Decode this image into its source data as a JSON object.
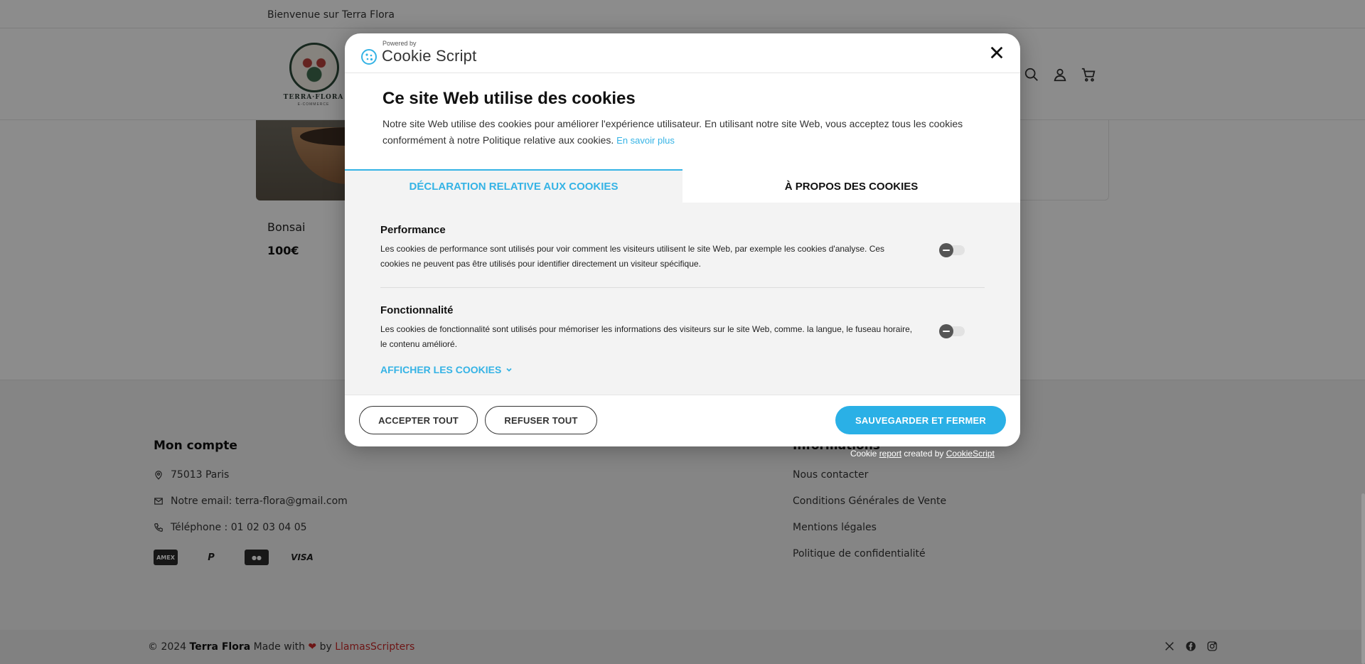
{
  "topbar": {
    "welcome": "Bienvenue sur Terra Flora"
  },
  "logo": {
    "name": "TERRA·FLORA",
    "sub": "E-COMMERCE"
  },
  "product": {
    "name": "Bonsai",
    "price": "100€"
  },
  "footer": {
    "account_title": "Mon compte",
    "address": "75013 Paris",
    "email": "Notre email: terra-flora@gmail.com",
    "phone": "Téléphone : 01 02 03 04 05",
    "payments": [
      "AMERICAN EXPRESS",
      "P",
      "MC",
      "VISA"
    ],
    "info_title": "Informations",
    "links": [
      "Nous contacter",
      "Conditions Générales de Vente",
      "Mentions légales",
      "Politique de confidentialité"
    ]
  },
  "bottombar": {
    "copy_prefix": "© 2024 ",
    "brand": "Terra Flora",
    "made_with": " Made with ",
    "heart": "❤",
    "by": " by ",
    "author": "LlamasScripters"
  },
  "dialog": {
    "powered_by": "Powered by",
    "brand_name": "Cookie Script",
    "title": "Ce site Web utilise des cookies",
    "text": "Notre site Web utilise des cookies pour améliorer l'expérience utilisateur. En utilisant notre site Web, vous acceptez tous les cookies conformément à notre Politique relative aux cookies.",
    "learn_more": "En savoir plus",
    "tabs": [
      {
        "label": "DÉCLARATION RELATIVE AUX COOKIES",
        "active": true
      },
      {
        "label": "À PROPOS DES COOKIES",
        "active": false
      }
    ],
    "categories": [
      {
        "title": "Performance",
        "description": "Les cookies de performance sont utilisés pour voir comment les visiteurs utilisent le site Web, par exemple les cookies d'analyse. Ces cookies ne peuvent pas être utilisés pour identifier directement un visiteur spécifique.",
        "enabled": false
      },
      {
        "title": "Fonctionnalité",
        "description": "Les cookies de fonctionnalité sont utilisés pour mémoriser les informations des visiteurs sur le site Web, comme. la langue, le fuseau horaire, le contenu amélioré.",
        "enabled": false
      }
    ],
    "show_cookies": "AFFICHER LES COOKIES",
    "buttons": {
      "accept_all": "ACCEPTER TOUT",
      "reject_all": "REFUSER TOUT",
      "save_close": "SAUVEGARDER ET FERMER"
    }
  },
  "credit": {
    "prefix": "Cookie ",
    "report": "report",
    "middle": " created by ",
    "link": "CookieScript"
  },
  "colors": {
    "accent": "#35b3e5",
    "primary_button": "#2ab0e6",
    "brand_red": "#c62828",
    "overlay": "rgba(0,0,0,0.45)"
  },
  "icons": [
    "search-icon",
    "user-icon",
    "cart-icon",
    "close-icon",
    "map-pin-icon",
    "mail-icon",
    "phone-icon",
    "x-icon",
    "facebook-icon",
    "instagram-icon",
    "chevron-down-icon",
    "cookie-icon"
  ]
}
